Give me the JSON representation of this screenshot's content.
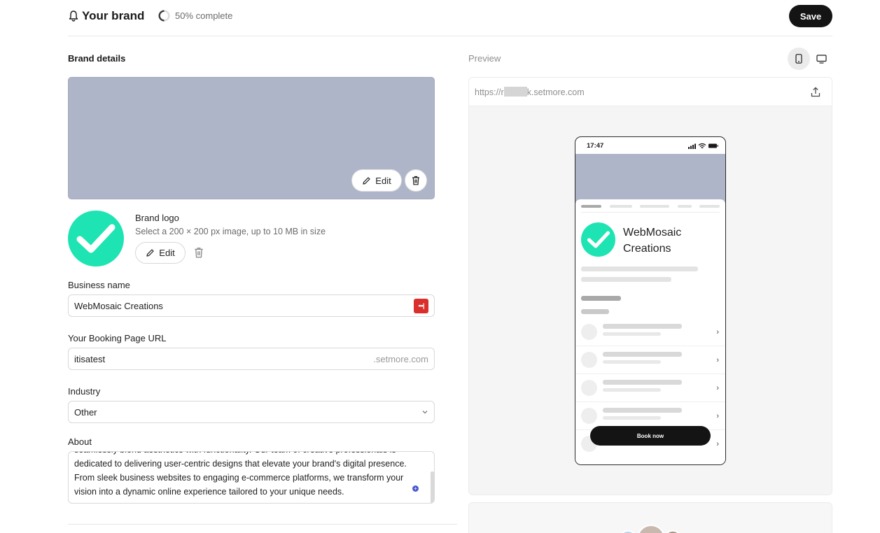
{
  "header": {
    "title": "Your brand",
    "progress_text": "50% complete",
    "progress_fraction": 0.5,
    "save_label": "Save"
  },
  "brand_details": {
    "section_title": "Brand details",
    "cover_edit_label": "Edit",
    "logo": {
      "title": "Brand logo",
      "hint": "Select a 200 × 200 px image, up to 10 MB in size",
      "edit_label": "Edit"
    },
    "business_name": {
      "label": "Business name",
      "value": "WebMosaic Creations",
      "badge": "•••|"
    },
    "booking_url": {
      "label": "Your Booking Page URL",
      "value": "itisatest",
      "suffix": ".setmore.com"
    },
    "industry": {
      "label": "Industry",
      "value": "Other"
    },
    "about": {
      "label": "About",
      "lines": [
        "seamlessly blend aesthetics with functionality. Our team of creative professionals is",
        "dedicated to delivering user-centric designs that elevate your brand's digital presence.",
        "From sleek business websites to engaging e-commerce platforms, we transform your",
        "vision into a dynamic online experience tailored to your unique needs."
      ]
    }
  },
  "preview": {
    "title": "Preview",
    "url_prefix": "https://r",
    "url_suffix": "k.setmore.com",
    "phone": {
      "time": "17:47",
      "business_name": "WebMosaic Creations",
      "book_label": "Book now",
      "service_chevron": "›"
    }
  },
  "colors": {
    "brand_green": "#1de4b2",
    "cover_gray": "#aeb5c8",
    "save_black": "#141414",
    "password_badge_red": "#d9302c"
  },
  "icons": {
    "brand": "bell-icon",
    "progress": "progress-ring-icon",
    "edit": "pencil-icon",
    "delete": "trash-icon",
    "logo": "checkmark-icon",
    "industry_dropdown": "chevron-down-icon",
    "share": "share-icon",
    "mobile_view": "mobile-device-icon",
    "desktop_view": "desktop-monitor-icon"
  }
}
